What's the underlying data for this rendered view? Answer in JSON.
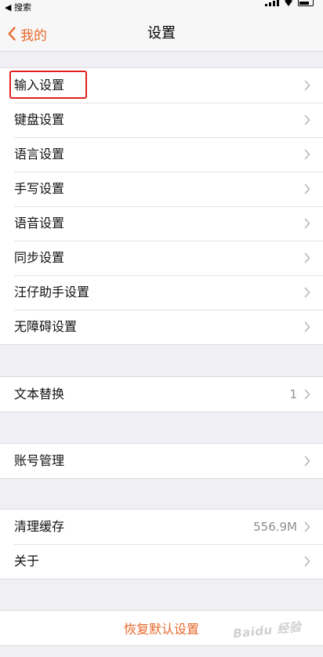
{
  "status_bar": {
    "back_label": "◀ 搜索"
  },
  "nav": {
    "back_label": "我的",
    "title": "设置"
  },
  "group1": [
    {
      "label": "输入设置"
    },
    {
      "label": "键盘设置"
    },
    {
      "label": "语言设置"
    },
    {
      "label": "手写设置"
    },
    {
      "label": "语音设置"
    },
    {
      "label": "同步设置"
    },
    {
      "label": "汪仔助手设置"
    },
    {
      "label": "无障碍设置"
    }
  ],
  "group2": [
    {
      "label": "文本替换",
      "value": "1"
    }
  ],
  "group3": [
    {
      "label": "账号管理"
    }
  ],
  "group4": [
    {
      "label": "清理缓存",
      "value": "556.9M"
    },
    {
      "label": "关于"
    }
  ],
  "reset": {
    "label": "恢复默认设置"
  },
  "watermark": "Baidu 经验",
  "colors": {
    "accent": "#e8682a",
    "highlight": "#e02020",
    "background": "#efeff4"
  }
}
